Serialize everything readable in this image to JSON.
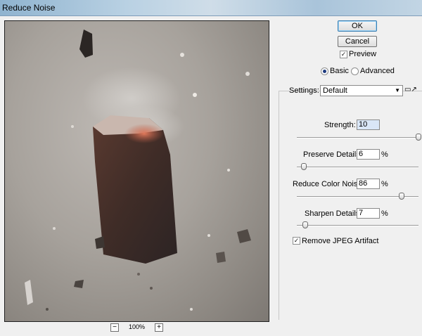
{
  "window": {
    "title": "Reduce Noise"
  },
  "preview": {
    "zoom_level": "100%"
  },
  "buttons": {
    "ok_label": "OK",
    "cancel_label": "Cancel"
  },
  "options": {
    "preview_label": "Preview",
    "preview_checked": true,
    "mode_basic_label": "Basic",
    "mode_advanced_label": "Advanced",
    "mode_selected": "Basic"
  },
  "settings": {
    "label": "Settings:",
    "value": "Default"
  },
  "controls": {
    "strength": {
      "label": "Strength:",
      "value": "10",
      "max": 10
    },
    "preserve_details": {
      "label": "Preserve Details:",
      "value": "6",
      "unit": "%",
      "max": 100
    },
    "reduce_color_noise": {
      "label": "Reduce Color Noise:",
      "value": "86",
      "unit": "%",
      "max": 100
    },
    "sharpen_details": {
      "label": "Sharpen Details:",
      "value": "7",
      "unit": "%",
      "max": 100
    },
    "remove_jpeg_artifact": {
      "label": "Remove JPEG Artifact",
      "checked": true
    }
  }
}
